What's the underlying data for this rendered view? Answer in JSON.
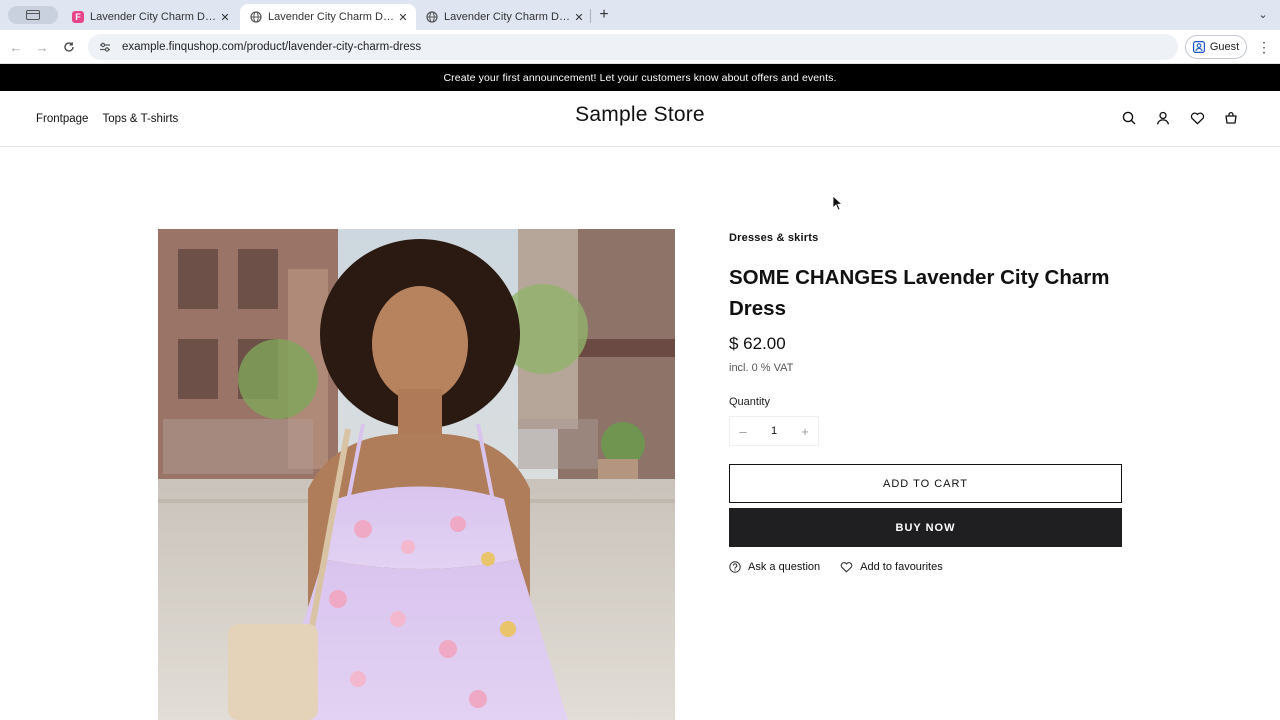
{
  "browser": {
    "tabs": [
      {
        "title": "Lavender City Charm Dress –",
        "favicon": "brand-icon",
        "active": false
      },
      {
        "title": "Lavender City Charm Dress –",
        "favicon": "globe-icon",
        "active": true
      },
      {
        "title": "Lavender City Charm Dress –",
        "favicon": "globe-icon",
        "active": false
      }
    ],
    "url": "example.finqushop.com/product/lavender-city-charm-dress",
    "profile_label": "Guest"
  },
  "store": {
    "announcement": "Create your first announcement! Let your customers know about offers and events.",
    "nav": [
      "Frontpage",
      "Tops & T-shirts"
    ],
    "logo": "Sample Store"
  },
  "product": {
    "category": "Dresses & skirts",
    "title": "SOME CHANGES Lavender City Charm Dress",
    "price": "$ 62.00",
    "vat": "incl. 0 % VAT",
    "quantity_label": "Quantity",
    "quantity_value": "1",
    "add_to_cart": "ADD TO CART",
    "buy_now": "BUY NOW",
    "ask_question": "Ask a question",
    "add_favourites": "Add to favourites"
  },
  "colors": {
    "announcement_bg": "#000000",
    "buy_now_bg": "#1f1f22",
    "tabbar_bg": "#dfe6f2",
    "dress": "#d9c3ef"
  }
}
